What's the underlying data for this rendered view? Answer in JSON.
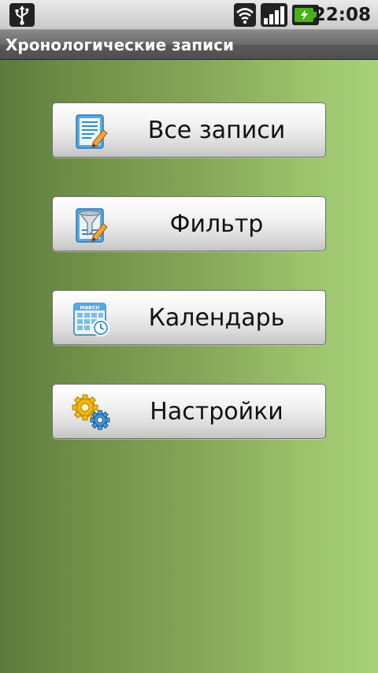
{
  "status_bar": {
    "time": "22:08",
    "icons": [
      "usb-icon",
      "wifi-icon",
      "signal-icon",
      "battery-charging-icon"
    ]
  },
  "app": {
    "title": "Хронологические записи"
  },
  "menu": {
    "items": [
      {
        "label": "Все записи",
        "icon": "notes-list-icon"
      },
      {
        "label": "Фильтр",
        "icon": "filter-icon"
      },
      {
        "label": "Календарь",
        "icon": "calendar-icon"
      },
      {
        "label": "Настройки",
        "icon": "gears-icon"
      }
    ],
    "calendar_icon_text": "MARCH"
  },
  "colors": {
    "background_dark": "#5c7a3c",
    "background_light": "#a8d27a",
    "button_face": "#f2f2f2",
    "title_bar": "#5a5a5a",
    "battery_green": "#4caf1e"
  }
}
